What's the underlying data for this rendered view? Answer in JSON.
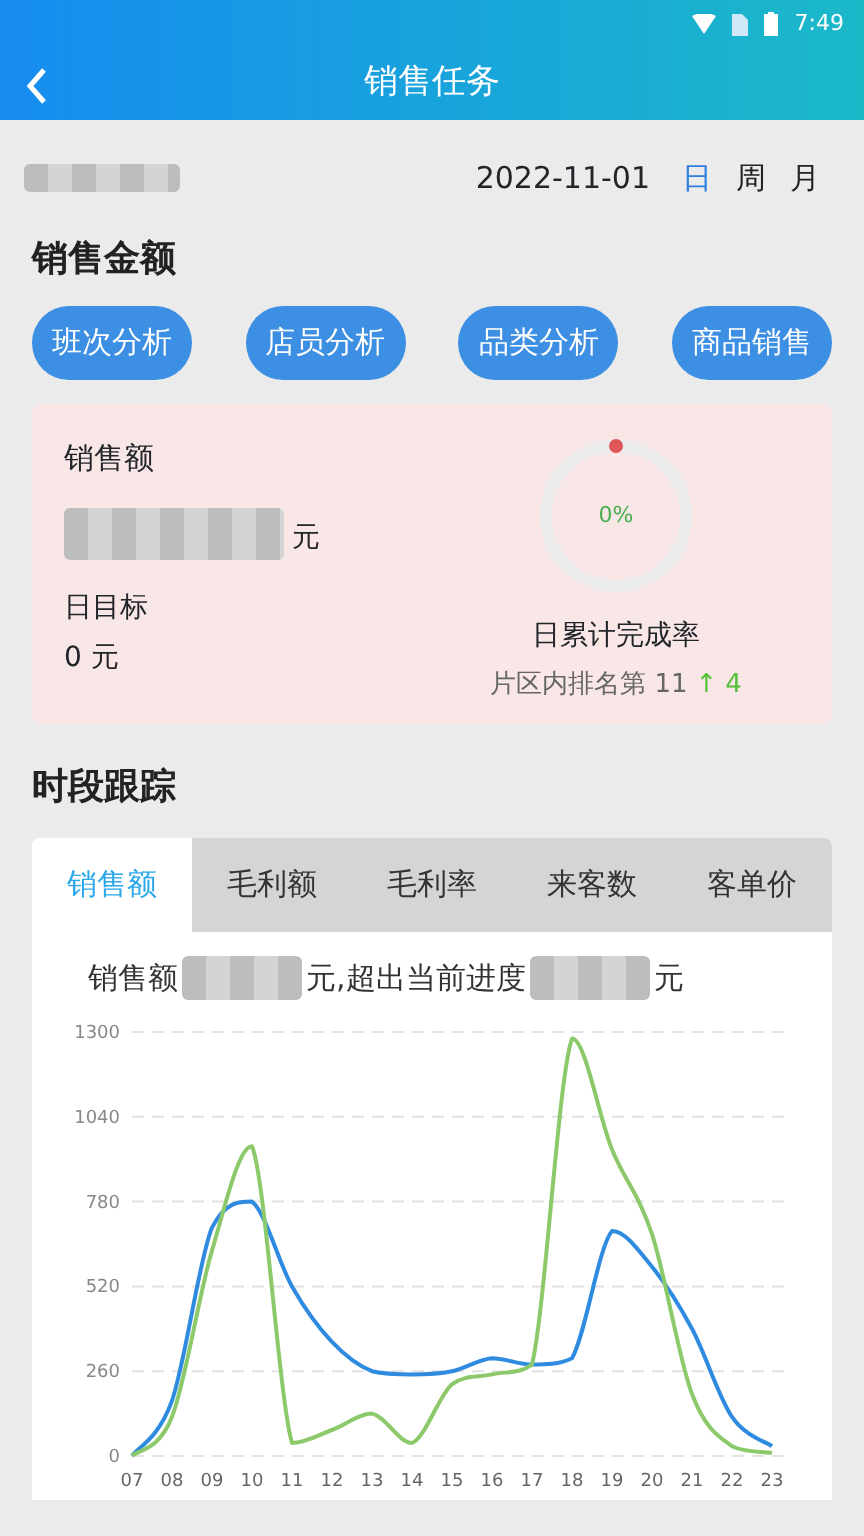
{
  "status_bar": {
    "time": "7:49"
  },
  "header": {
    "title": "销售任务"
  },
  "date_bar": {
    "date": "2022-11-01",
    "periods": [
      {
        "label": "日",
        "selected": true
      },
      {
        "label": "周",
        "selected": false
      },
      {
        "label": "月",
        "selected": false
      }
    ]
  },
  "sales_section": {
    "title": "销售金额",
    "buttons": [
      "班次分析",
      "店员分析",
      "品类分析",
      "商品销售"
    ]
  },
  "summary_card": {
    "label": "销售额",
    "amount_unit": "元",
    "target_label": "日目标",
    "target_value": "0 元",
    "progress": {
      "reading": "0%"
    },
    "completion_label": "日累计完成率",
    "rank_text": "片区内排名第 11",
    "rank_arrow": "↑",
    "rank_change": "4"
  },
  "tracking_section": {
    "title": "时段跟踪",
    "tabs": [
      {
        "label": "销售额",
        "selected": true
      },
      {
        "label": "毛利额",
        "selected": false
      },
      {
        "label": "毛利率",
        "selected": false
      },
      {
        "label": "来客数",
        "selected": false
      },
      {
        "label": "客单价",
        "selected": false
      }
    ],
    "summary_parts": [
      "销售额",
      "元,超出当前进度",
      "元"
    ],
    "chart_data": {
      "type": "line",
      "grid": true,
      "categories": [
        "07",
        "08",
        "09",
        "10",
        "11",
        "12",
        "13",
        "14",
        "15",
        "16",
        "17",
        "18",
        "19",
        "20",
        "21",
        "22",
        "23"
      ],
      "ylim": [
        0,
        1300
      ],
      "yticks": [
        0,
        260,
        520,
        780,
        1040,
        1300
      ],
      "series": [
        {
          "color": "#2f8be0",
          "values": [
            0,
            170,
            700,
            780,
            520,
            350,
            260,
            250,
            260,
            300,
            280,
            300,
            690,
            580,
            390,
            120,
            30
          ]
        },
        {
          "color": "#8cc96a",
          "values": [
            0,
            120,
            630,
            950,
            40,
            80,
            130,
            40,
            220,
            250,
            280,
            1280,
            940,
            680,
            190,
            30,
            10
          ]
        }
      ]
    }
  }
}
